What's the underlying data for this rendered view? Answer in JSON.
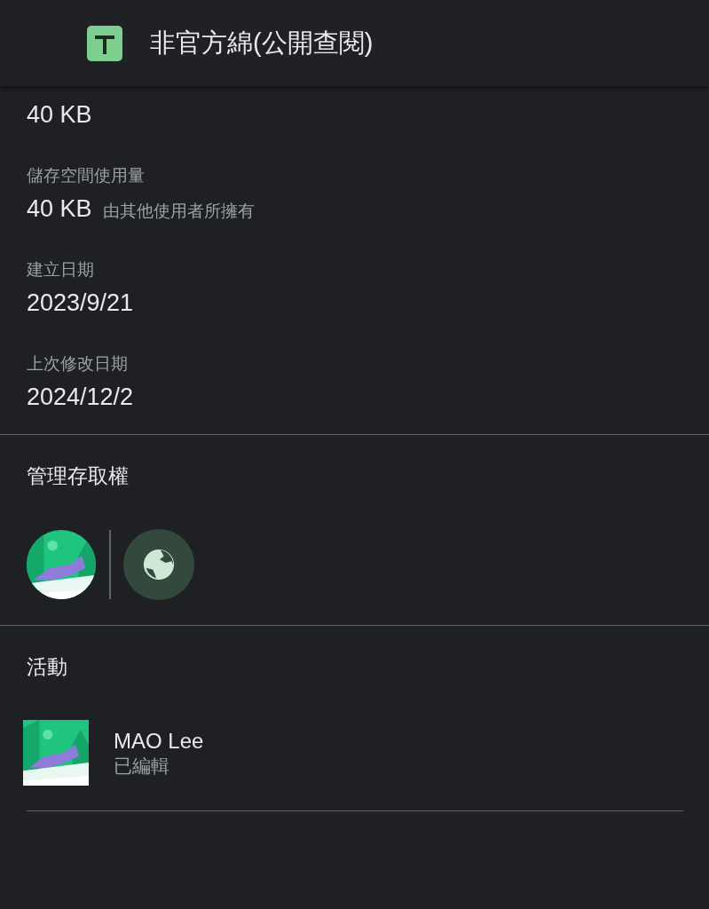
{
  "header": {
    "title": "非官方綿(公開查閱)"
  },
  "details": [
    {
      "value": "40 KB"
    },
    {
      "label": "儲存空間使用量",
      "value": "40 KB",
      "note": "由其他使用者所擁有"
    },
    {
      "label": "建立日期",
      "value": "2023/9/21"
    },
    {
      "label": "上次修改日期",
      "value": "2024/12/2"
    }
  ],
  "access": {
    "heading": "管理存取權",
    "members": [
      {
        "kind": "picture"
      },
      {
        "kind": "globe"
      }
    ]
  },
  "activity": {
    "heading": "活動",
    "entries": [
      {
        "name": "MAO Lee",
        "action": "已編輯"
      }
    ]
  }
}
